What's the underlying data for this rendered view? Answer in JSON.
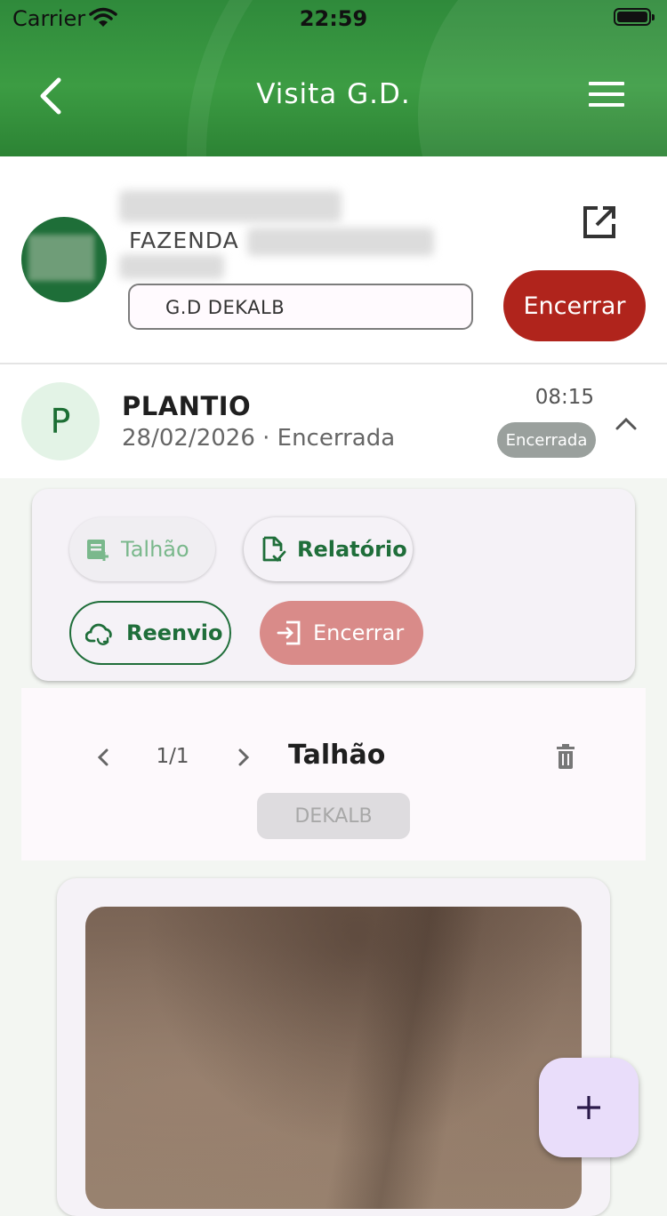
{
  "status_bar": {
    "carrier": "Carrier",
    "time": "22:59"
  },
  "header": {
    "title": "Visita G.D."
  },
  "profile": {
    "farm_label": "FAZENDA",
    "tag": "G.D DEKALB",
    "end_button": "Encerrar"
  },
  "visit": {
    "avatar_letter": "P",
    "title": "PLANTIO",
    "subtitle": "28/02/2026 · Encerrada",
    "time": "08:15",
    "badge": "Encerrada"
  },
  "actions": {
    "talhao": "Talhão",
    "relatorio": "Relatório",
    "reenvio": "Reenvio",
    "encerrar": "Encerrar"
  },
  "plot": {
    "counter": "1/1",
    "title": "Talhão",
    "hybrid_button": "DEKALB"
  },
  "colors": {
    "brand_green": "#2f8a3b",
    "danger_red": "#b0241c",
    "disabled_red": "#d98b89",
    "fab_bg": "#e9ddfa"
  },
  "icons": [
    "back-arrow-icon",
    "menu-icon",
    "open-external-icon",
    "chevron-up-icon",
    "add-note-icon",
    "document-check-icon",
    "cloud-sync-icon",
    "exit-icon",
    "chevron-left-icon",
    "chevron-right-icon",
    "trash-icon",
    "plus-icon",
    "wifi-icon",
    "battery-icon"
  ]
}
